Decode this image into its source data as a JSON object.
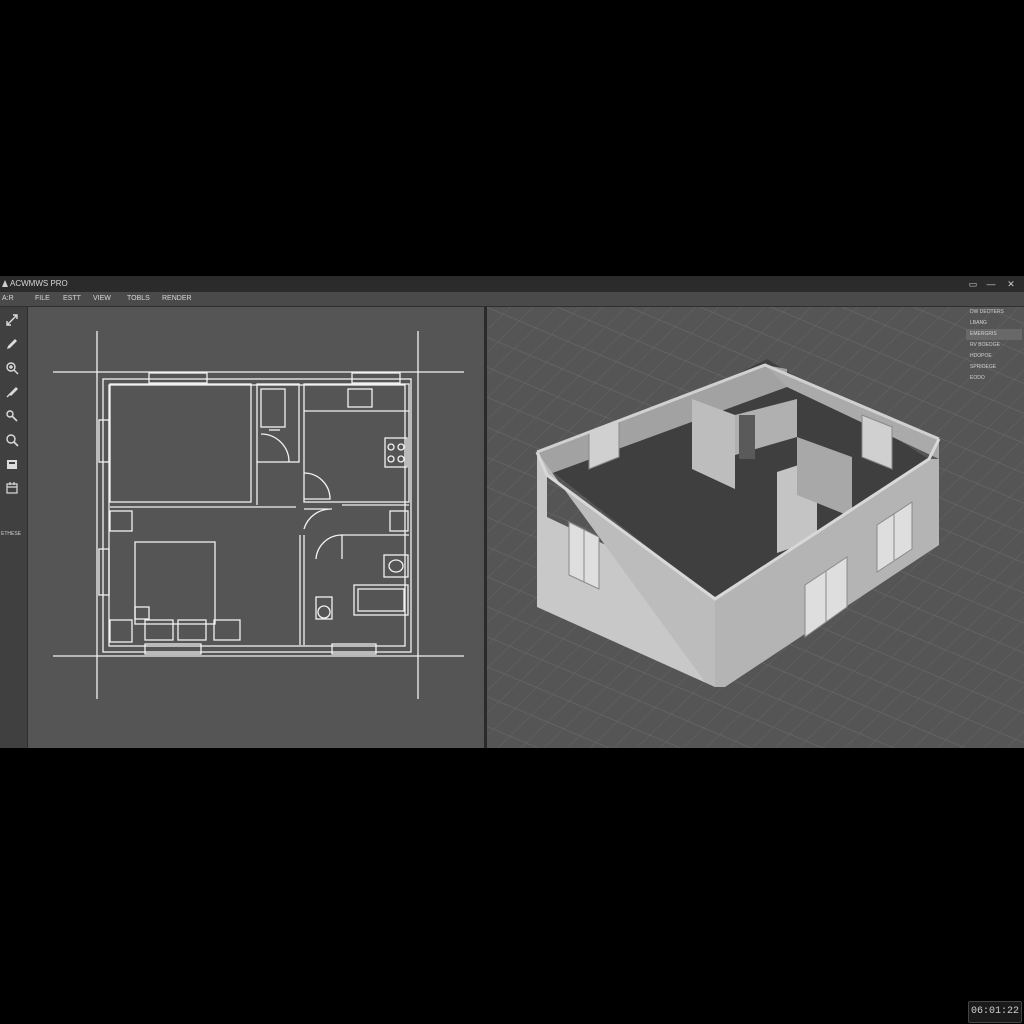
{
  "app": {
    "title": "ACWMWS PRO"
  },
  "window_controls": {
    "restore": "▭",
    "minimize": "—",
    "close": "✕"
  },
  "menu": {
    "items": [
      "A:R",
      "FILE",
      "ESTT",
      "VIEW",
      "TOBLS",
      "RENDER"
    ]
  },
  "toolbar": {
    "tools": [
      "transform-icon",
      "pencil-icon",
      "zoom-icon",
      "brush-icon",
      "node-icon",
      "zoom-search-icon",
      "layer-icon",
      "calendar-icon"
    ],
    "label": "ETHESE"
  },
  "properties_panel": {
    "items": [
      "DW DEOTERS",
      "LBANG",
      "EMERGRIS",
      "RV BOEOGE",
      "HDOPOE",
      "SPRIOEGE",
      "EODO"
    ]
  },
  "status": {
    "timecode": "06:01:22"
  },
  "colors": {
    "background": "#000000",
    "plan_bg": "#555555",
    "viewport_bg": "#5a5a5a",
    "line": "#f2f2f2"
  }
}
